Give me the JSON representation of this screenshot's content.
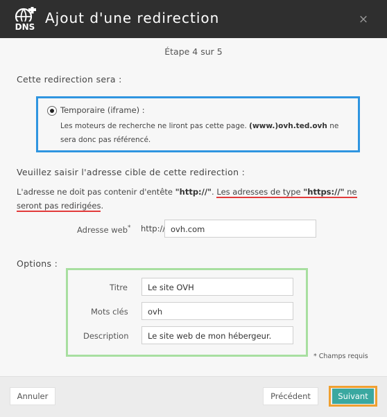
{
  "header": {
    "logo_text": "DNS",
    "title": "Ajout d'une redirection"
  },
  "close_symbol": "×",
  "step": "Étape 4 sur 5",
  "redirect_type": {
    "heading": "Cette redirection sera :",
    "option_label": "Temporaire (iframe) :",
    "desc_before": "Les moteurs de recherche ne liront pas cette page.",
    "desc_bold": "(www.)ovh.ted.ovh",
    "desc_after": "ne sera donc pas référencé.",
    "border_color": "#2f95e0"
  },
  "target": {
    "heading": "Veuillez saisir l'adresse cible de cette redirection :",
    "warn_p1": "L'adresse ne doit pas contenir d'entête",
    "warn_bold1": "\"http://\"",
    "warn_p2": ". ",
    "warn_ul1": "Les adresses de type",
    "warn_bold2": "\"https://\"",
    "warn_ul2": "ne seront pas redirigées",
    "warn_end": ".",
    "underline_color": "#e23a3a",
    "address_label": "Adresse web",
    "required_mark": "*",
    "prefix": "http://",
    "address_value": "ovh.com"
  },
  "options": {
    "heading": "Options :",
    "title_label": "Titre",
    "title_value": "Le site OVH",
    "keywords_label": "Mots clés",
    "keywords_value": "ovh",
    "description_label": "Description",
    "description_value": "Le site web de mon hébergeur.",
    "border_color": "#a8dfa0"
  },
  "required_note": "* Champs requis",
  "buttons": {
    "cancel": "Annuler",
    "previous": "Précédent",
    "next": "Suivant",
    "next_color": "#3aa8a0",
    "next_highlight_color": "#f0a030"
  }
}
